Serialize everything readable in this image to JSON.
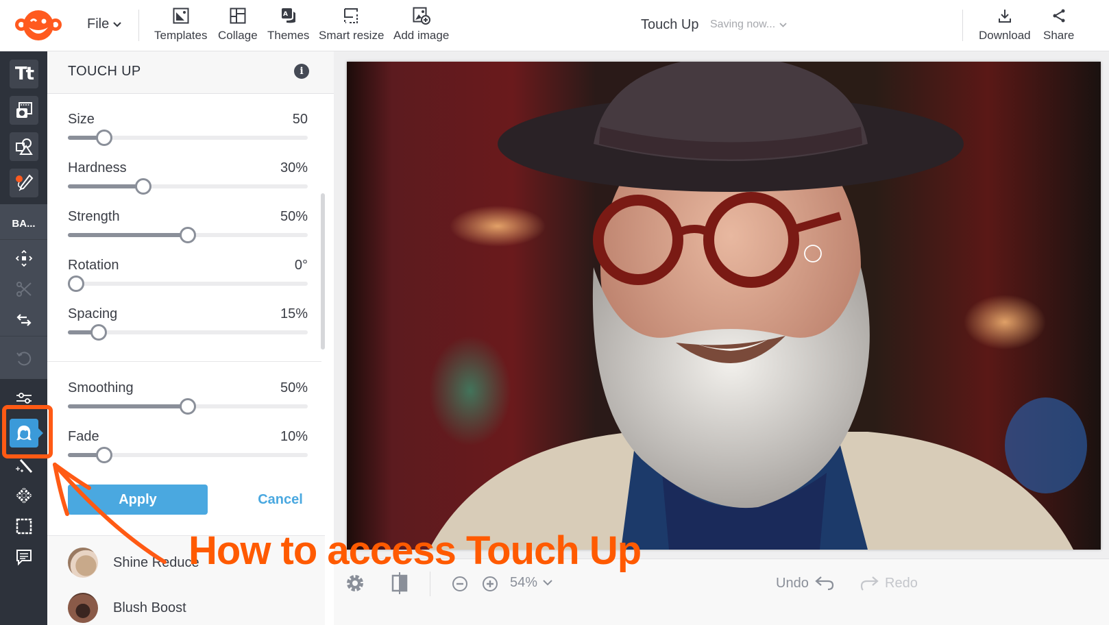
{
  "topbar": {
    "logo": "picmonkey-monkey-logo",
    "file_menu": "File",
    "tools": [
      {
        "label": "Templates",
        "icon": "templates-icon"
      },
      {
        "label": "Collage",
        "icon": "collage-icon"
      },
      {
        "label": "Themes",
        "icon": "themes-icon"
      },
      {
        "label": "Smart resize",
        "icon": "smart-resize-icon"
      },
      {
        "label": "Add image",
        "icon": "add-image-icon"
      }
    ],
    "doc_title": "Touch Up",
    "save_status": "Saving now...",
    "actions": [
      {
        "label": "Download",
        "icon": "download-icon"
      },
      {
        "label": "Share",
        "icon": "share-icon"
      }
    ]
  },
  "rail": {
    "top_tools": [
      "text-tool",
      "photo-graphics-tool",
      "shapes-tool",
      "draw-tool"
    ],
    "section_label": "BA...",
    "basic_tools": [
      "transform",
      "cut",
      "flip",
      "undo-rotate"
    ],
    "bottom_tools": [
      "adjustments",
      "touch-up",
      "effects-wand",
      "textures",
      "frames",
      "comments"
    ],
    "active_tool": "touch-up",
    "accent": "#3b9ad9"
  },
  "panel": {
    "title": "TOUCH UP",
    "sliders_group1": [
      {
        "name": "Size",
        "value": "50",
        "fraction": 0.125
      },
      {
        "name": "Hardness",
        "value": "30%",
        "fraction": 0.3
      },
      {
        "name": "Strength",
        "value": "50%",
        "fraction": 0.5
      },
      {
        "name": "Rotation",
        "value": "0°",
        "fraction": 0.0
      },
      {
        "name": "Spacing",
        "value": "15%",
        "fraction": 0.1
      }
    ],
    "sliders_group2": [
      {
        "name": "Smoothing",
        "value": "50%",
        "fraction": 0.5
      },
      {
        "name": "Fade",
        "value": "10%",
        "fraction": 0.125
      }
    ],
    "apply_label": "Apply",
    "cancel_label": "Cancel",
    "effects": [
      {
        "name": "Shine Reduce"
      },
      {
        "name": "Blush Boost"
      }
    ]
  },
  "bottombar": {
    "zoom": "54%",
    "undo_label": "Undo",
    "redo_label": "Redo"
  },
  "annotation": {
    "text": "How to access Touch Up",
    "color": "#ff5a00"
  }
}
